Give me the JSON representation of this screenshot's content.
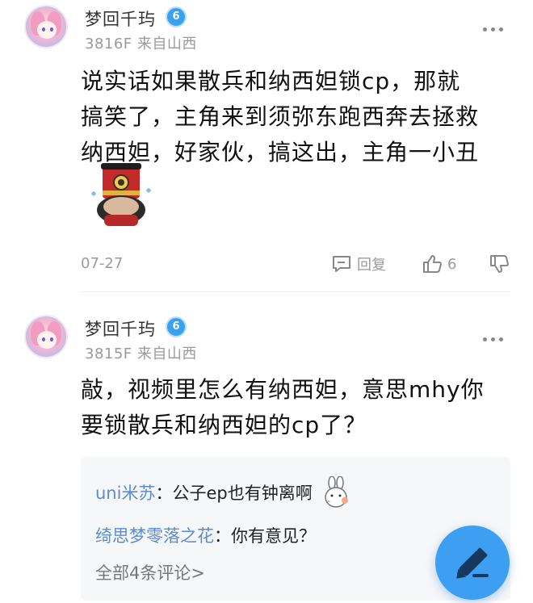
{
  "posts": [
    {
      "username": "梦回千玙",
      "level": "6",
      "floor_meta": "3816F 来自山西",
      "content": [
        "说实话如果散兵和纳西妲锁cp，那就",
        "搞笑了，主角来到须弥东跑西奔去拯救",
        "纳西妲，好家伙，搞这出，主角一小丑"
      ],
      "date": "07-27",
      "reply_label": "回复",
      "like_count": "6"
    },
    {
      "username": "梦回千玙",
      "level": "6",
      "floor_meta": "3815F 来自山西",
      "content": [
        "敲，视频里怎么有纳西妲，意思mhy你",
        "要锁散兵和纳西妲的cp了？"
      ],
      "replies": [
        {
          "name": "uni米苏",
          "text": "：公子ep也有钟离啊"
        },
        {
          "name": "绮思梦零落之花",
          "text": "：你有意见？"
        }
      ],
      "all_comments": "全部4条评论>"
    }
  ],
  "colors": {
    "accent": "#3d9ff2",
    "reply_name": "#5b8ccf",
    "meta": "#9a9a9a"
  },
  "icons": [
    "more-dots-icon",
    "comment-icon",
    "thumbs-up-icon",
    "thumbs-down-icon",
    "pen-icon",
    "level-badge-icon"
  ]
}
